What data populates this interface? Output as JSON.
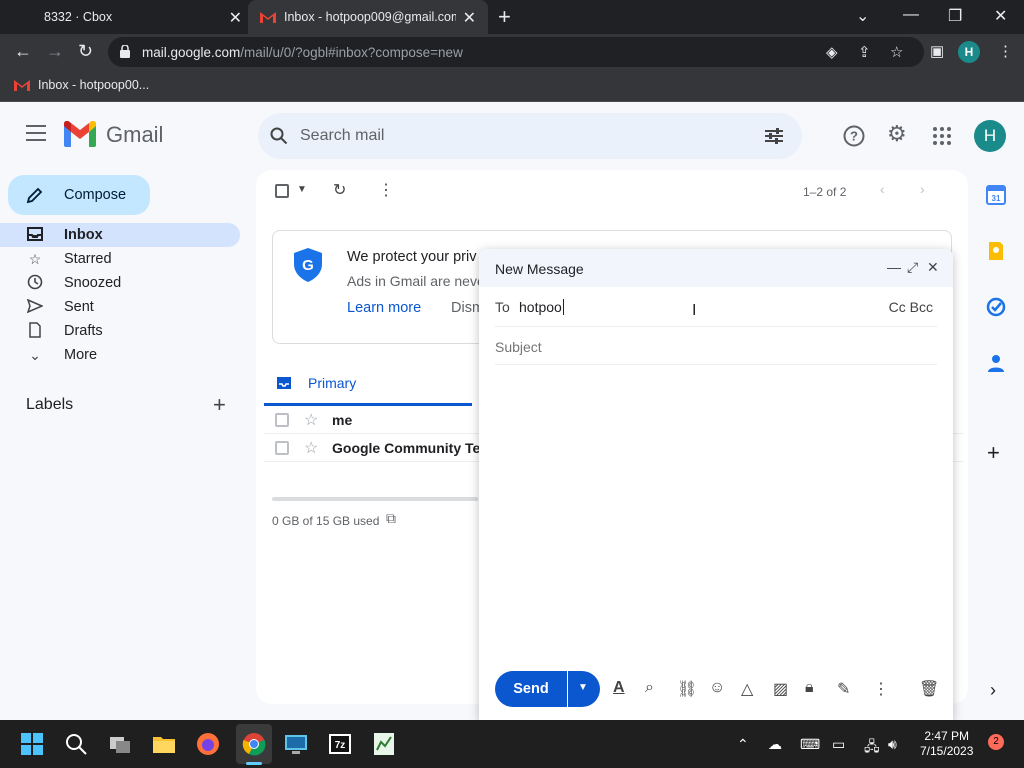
{
  "browser": {
    "tabs": [
      {
        "title": "8332 · Cbox"
      },
      {
        "title": "Inbox - hotpoop009@gmail.com"
      }
    ],
    "url_main": "mail.google.com",
    "url_rest": "/mail/u/0/?ogbl#inbox?compose=new",
    "profile_initial": "H",
    "bookmark": "Inbox - hotpoop00..."
  },
  "header": {
    "app_name": "Gmail",
    "search_placeholder": "Search mail",
    "avatar_initial": "H"
  },
  "sidebar": {
    "compose_label": "Compose",
    "items": [
      {
        "label": "Inbox",
        "icon": "inbox-icon"
      },
      {
        "label": "Starred",
        "icon": "star-icon"
      },
      {
        "label": "Snoozed",
        "icon": "clock-icon"
      },
      {
        "label": "Sent",
        "icon": "send-icon"
      },
      {
        "label": "Drafts",
        "icon": "draft-icon"
      },
      {
        "label": "More",
        "icon": "chevron-down-icon"
      }
    ],
    "labels_title": "Labels"
  },
  "mail": {
    "pager": "1–2 of 2",
    "promo_title": "We protect your priv",
    "promo_sub": "Ads in Gmail are neve",
    "promo_learn": "Learn more",
    "promo_dismiss": "Dism",
    "tab_primary": "Primary",
    "rows": [
      {
        "sender": "me"
      },
      {
        "sender": "Google Community Te"
      }
    ],
    "storage": "0 GB of 15 GB used"
  },
  "composer": {
    "title": "New Message",
    "to_label": "To",
    "to_value": "hotpoo",
    "cc_bcc": "Cc Bcc",
    "subject_placeholder": "Subject",
    "send_label": "Send"
  },
  "taskbar": {
    "time": "2:47 PM",
    "date": "7/15/2023",
    "notifications": "2"
  },
  "colors": {
    "accent": "#0b57d0",
    "compose_bg": "#c2e7ff",
    "active_nav": "#d3e3fd"
  }
}
